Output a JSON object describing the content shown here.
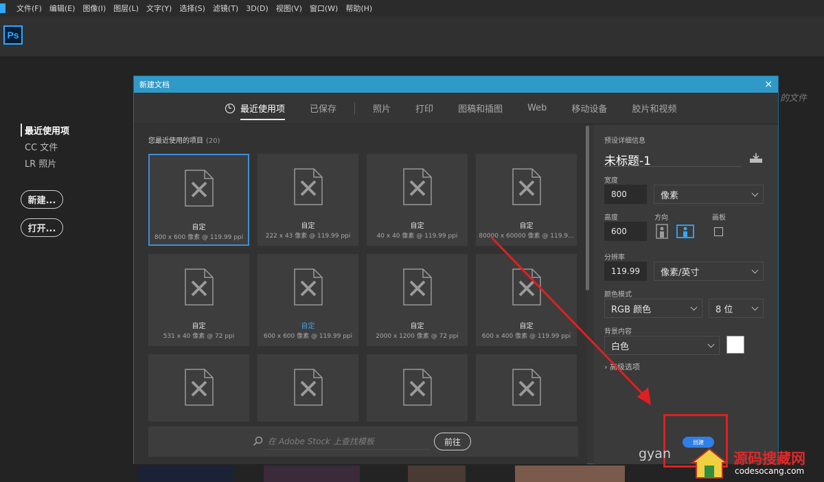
{
  "menu": {
    "items": [
      "文件(F)",
      "编辑(E)",
      "图像(I)",
      "图层(L)",
      "文字(Y)",
      "选择(S)",
      "滤镜(T)",
      "3D(D)",
      "视图(V)",
      "窗口(W)",
      "帮助(H)"
    ]
  },
  "app": {
    "logo": "Ps"
  },
  "start": {
    "nav": [
      "最近使用项",
      "CC 文件",
      "LR 照片"
    ],
    "new_label": "新建...",
    "open_label": "打开...",
    "bg_text": "的文件"
  },
  "dialog": {
    "title": "新建文档",
    "close": "×",
    "tabs": [
      "最近使用项",
      "已保存",
      "照片",
      "打印",
      "图稿和插图",
      "Web",
      "移动设备",
      "胶片和视频"
    ],
    "recent_title": "您最近使用的项目",
    "recent_count": "(20)",
    "presets": [
      {
        "name": "自定",
        "size": "800 x 600 像素 @ 119.99 ppi"
      },
      {
        "name": "自定",
        "size": "222 x 43 像素 @ 119.99 ppi"
      },
      {
        "name": "自定",
        "size": "40 x 40 像素 @ 119.99 ppi"
      },
      {
        "name": "自定",
        "size": "80000 x 60000 像素 @ 119.9..."
      },
      {
        "name": "自定",
        "size": "531 x 40 像素 @ 72 ppi"
      },
      {
        "name": "自定",
        "size": "600 x 600 像素 @ 119.99 ppi"
      },
      {
        "name": "自定",
        "size": "2000 x 1200 像素 @ 72 ppi"
      },
      {
        "name": "自定",
        "size": "600 x 400 像素 @ 119.99 ppi"
      }
    ],
    "stock": {
      "placeholder": "在 Adobe Stock 上查找模板",
      "go": "前往"
    },
    "details": {
      "header": "预设详细信息",
      "name": "未标题-1",
      "width_label": "宽度",
      "width_value": "800",
      "width_unit": "像素",
      "height_label": "高度",
      "height_value": "600",
      "orientation_label": "方向",
      "artboard_label": "画板",
      "resolution_label": "分辨率",
      "resolution_value": "119.99",
      "resolution_unit": "像素/英寸",
      "colormode_label": "颜色模式",
      "colormode_value": "RGB 颜色",
      "bitdepth_value": "8 位",
      "bg_label": "背景内容",
      "bg_value": "白色",
      "bg_color": "#ffffff",
      "advanced": "高级选项",
      "create_label": "创建"
    }
  },
  "watermark": {
    "site_cn": "源码搜藏网",
    "site_en": "codesocang.com",
    "partial": "gyan"
  },
  "colors": {
    "accent": "#31a8ff",
    "dialog_title": "#2f9ac8",
    "annotation": "#e02020",
    "selected_border": "#3c8fd8"
  }
}
